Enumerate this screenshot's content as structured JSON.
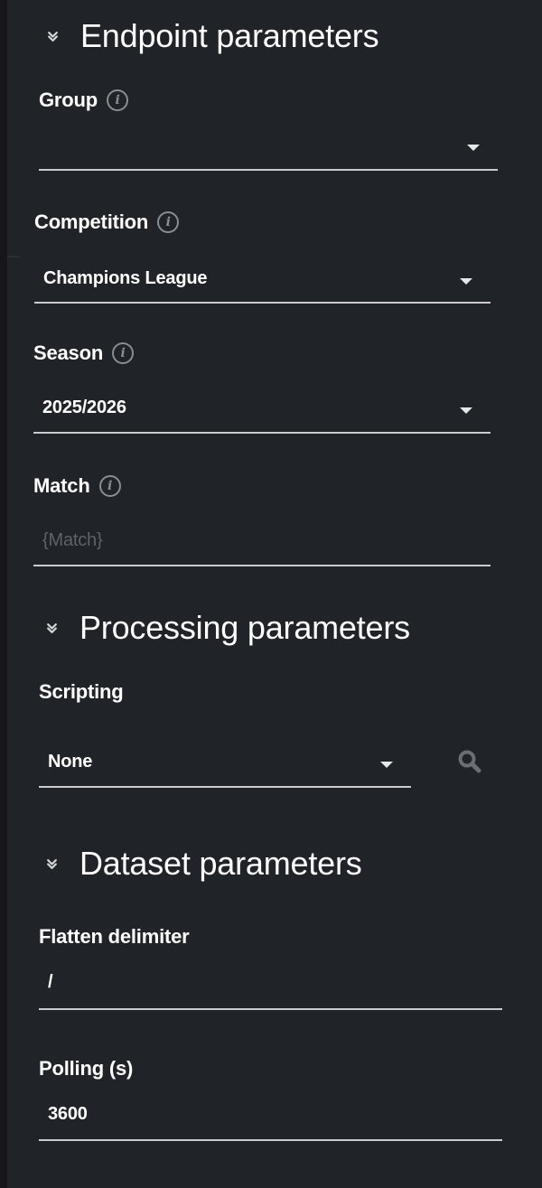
{
  "sections": {
    "endpoint": {
      "title": "Endpoint parameters",
      "fields": {
        "group": {
          "label": "Group",
          "value": ""
        },
        "competition": {
          "label": "Competition",
          "value": "Champions League"
        },
        "season": {
          "label": "Season",
          "value": "2025/2026"
        },
        "match": {
          "label": "Match",
          "placeholder": "{Match}"
        }
      }
    },
    "processing": {
      "title": "Processing parameters",
      "fields": {
        "scripting": {
          "label": "Scripting",
          "value": "None"
        }
      }
    },
    "dataset": {
      "title": "Dataset parameters",
      "fields": {
        "flatten_delimiter": {
          "label": "Flatten delimiter",
          "value": "/"
        },
        "polling": {
          "label": "Polling (s)",
          "value": "3600"
        }
      }
    }
  },
  "icons": {
    "section_toggle": "double-chevron-down-icon",
    "info": "info-icon",
    "dropdown": "caret-down-icon",
    "search": "search-icon"
  },
  "colors": {
    "background": "#202327",
    "text": "#ffffff",
    "muted": "#8a8d91",
    "underline": "#c9cbcf"
  }
}
